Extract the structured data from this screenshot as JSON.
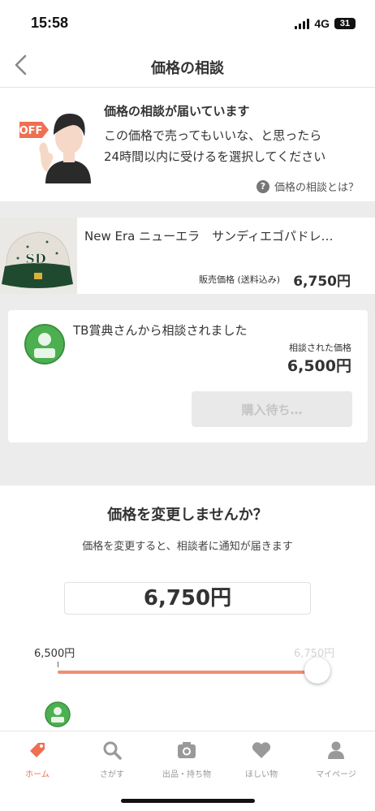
{
  "status_bar": {
    "time": "15:58",
    "network": "4G",
    "battery": "31"
  },
  "nav": {
    "title": "価格の相談",
    "back_icon": "chevron-left-icon"
  },
  "notice": {
    "badge": "OFF",
    "title": "価格の相談が届いています",
    "body_line1": "この価格で売ってもいいな、と思ったら",
    "body_line2": "24時間以内に受けるを選択してください",
    "help_link": "価格の相談とは？"
  },
  "product": {
    "name": "New Era ニューエラ　サンディエゴパドレ…",
    "price_label": "販売価格 (送料込み)",
    "price": "6,750円"
  },
  "offer": {
    "message": "TB賞典さんから相談されました",
    "price_label": "相談された価格",
    "price": "6,500円",
    "button_label": "購入待ち…"
  },
  "change": {
    "title": "価格を変更しませんか？",
    "description": "価格を変更すると、相談者に通知が届きます",
    "price": "6,750円",
    "slider_min_label": "6,500円",
    "slider_max_label": "6,750円",
    "slider_value_fraction": 1.0
  },
  "tabs": [
    {
      "label": "ホーム",
      "icon": "tag-icon",
      "active": true
    },
    {
      "label": "さがす",
      "icon": "search-icon",
      "active": false
    },
    {
      "label": "出品・持ち物",
      "icon": "camera-icon",
      "active": false
    },
    {
      "label": "ほしい物",
      "icon": "heart-icon",
      "active": false
    },
    {
      "label": "マイページ",
      "icon": "person-icon",
      "active": false
    }
  ],
  "colors": {
    "accent": "#ef6f53",
    "slider": "#f08d76",
    "avatar": "#4caf50",
    "gray_bg": "#ececec"
  }
}
